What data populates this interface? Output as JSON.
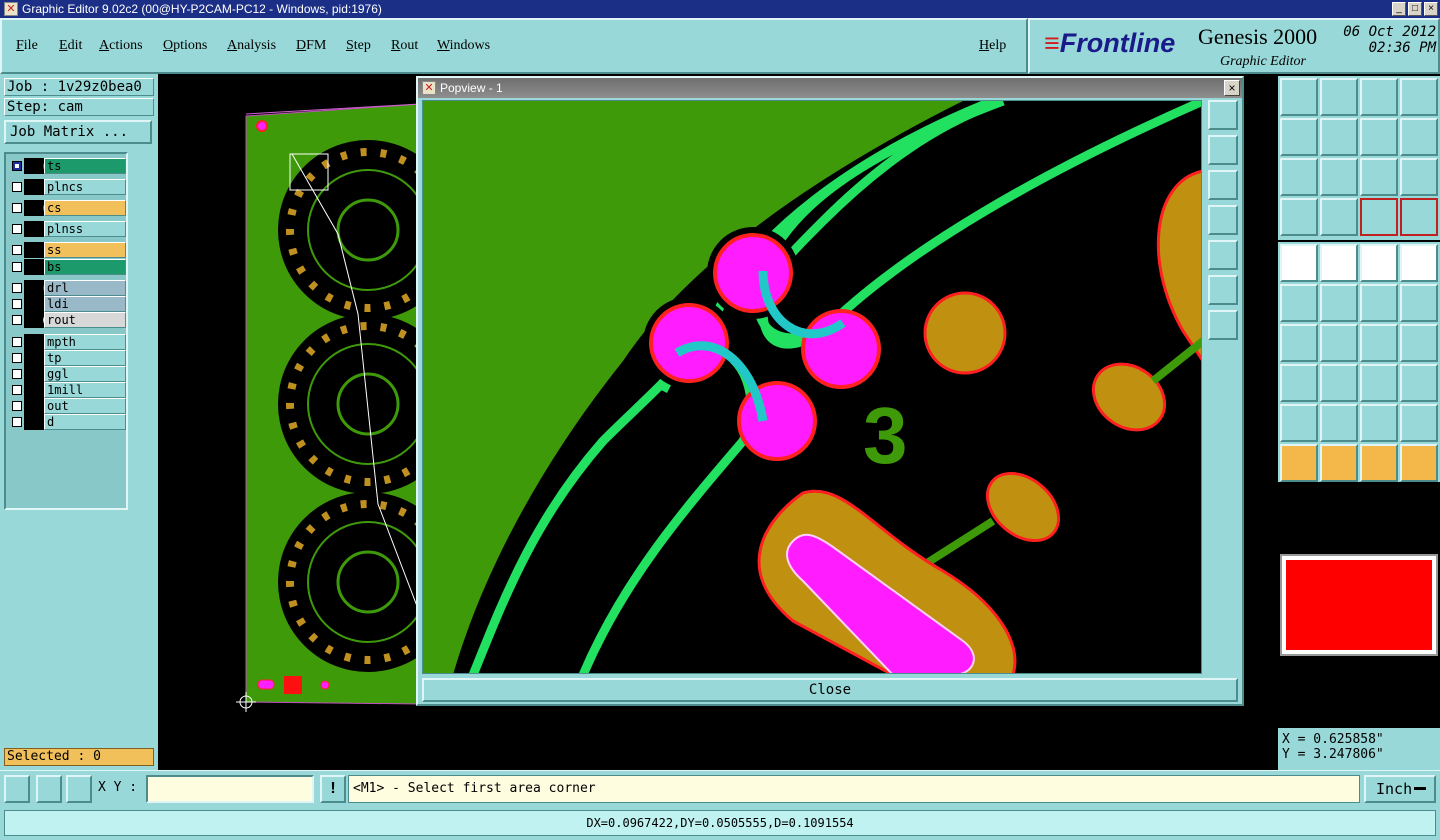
{
  "window": {
    "title": "Graphic Editor 9.02c2 (00@HY-P2CAM-PC12 - Windows, pid:1976)"
  },
  "menu": [
    "File",
    "Edit",
    "Actions",
    "Options",
    "Analysis",
    "DFM",
    "Step",
    "Rout",
    "Windows"
  ],
  "help": "Help",
  "brand": {
    "logo": "Frontline",
    "product": "Genesis 2000",
    "subtitle": "Graphic Editor",
    "date": "06 Oct 2012",
    "time": "02:36 PM"
  },
  "job": {
    "job_line": "Job : 1v29z0bea0",
    "step_line": "Step: cam",
    "matrix_button": "Job Matrix ..."
  },
  "layers": [
    {
      "name": "ts",
      "color": "#e02020",
      "bg": "#1d9a6c",
      "checked": true
    },
    {
      "name": "plncs",
      "color": "",
      "bg": "#99d8d8",
      "checked": false
    },
    {
      "name": "cs",
      "color": "#3aa020",
      "bg": "#f2c05a",
      "checked": false
    },
    {
      "name": "plnss",
      "color": "",
      "bg": "#99d8d8",
      "checked": false
    },
    {
      "name": "ss",
      "color": "",
      "bg": "#f2c05a",
      "checked": false
    },
    {
      "name": "bs",
      "color": "",
      "bg": "#1d9a6c",
      "checked": false
    },
    {
      "name": "drl",
      "color": "#1c2fe0",
      "bg": "#99b8c8",
      "checked": false
    },
    {
      "name": "ldi",
      "color": "",
      "bg": "#99b8c8",
      "checked": false
    },
    {
      "name": "rout",
      "color": "#f0e020",
      "bg": "#d8d8d8",
      "checked": false
    },
    {
      "name": "mpth",
      "color": "",
      "bg": "#99d8d8",
      "checked": false
    },
    {
      "name": "tp",
      "color": "",
      "bg": "#99d8d8",
      "checked": false
    },
    {
      "name": "ggl",
      "color": "",
      "bg": "#99d8d8",
      "checked": false
    },
    {
      "name": "1mill",
      "color": "",
      "bg": "#99d8d8",
      "checked": false
    },
    {
      "name": "out",
      "color": "",
      "bg": "#99d8d8",
      "checked": false
    },
    {
      "name": "d",
      "color": "",
      "bg": "#99d8d8",
      "checked": false
    }
  ],
  "selected": "Selected : 0",
  "popview": {
    "title": "Popview - 1",
    "close_label": "Close",
    "label3": "3"
  },
  "coords": {
    "x": "X = 0.625858\"",
    "y": "Y = 3.247806\""
  },
  "status": {
    "xy_label": "X Y :",
    "xy_value": "",
    "excl": "!",
    "prompt": "<M1> - Select first area corner",
    "unit": "Inch"
  },
  "distance": "DX=0.0967422,DY=0.0505555,D=0.1091554"
}
